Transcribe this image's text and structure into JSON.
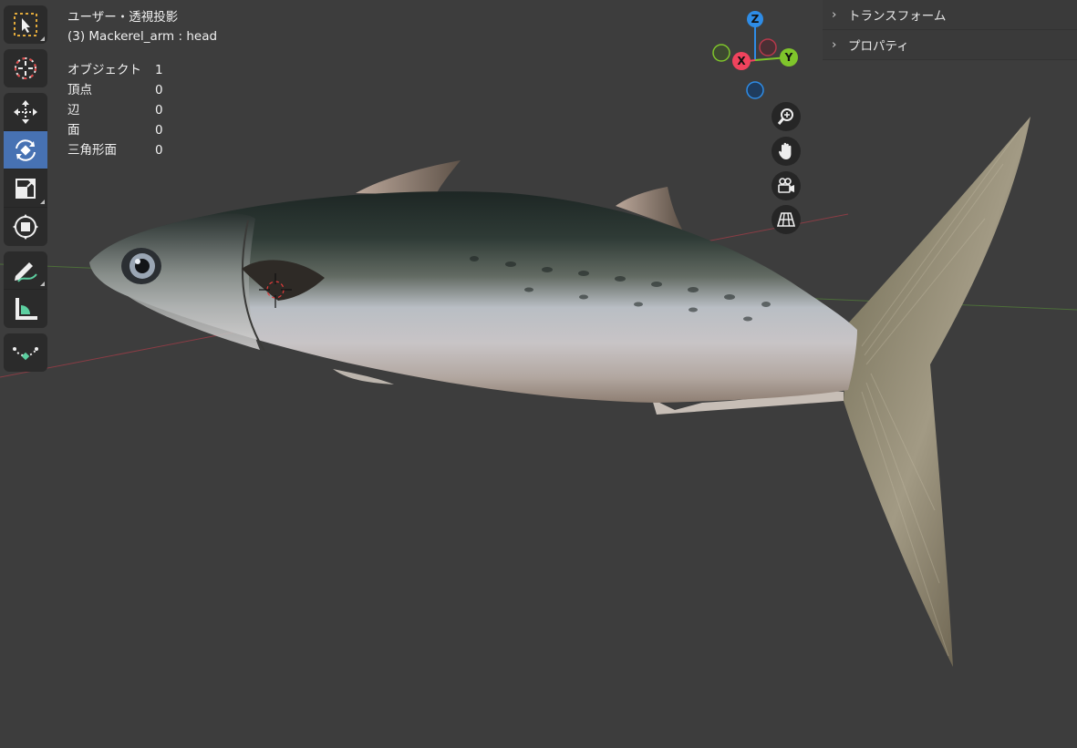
{
  "viewport": {
    "view_name": "ユーザー・透視投影",
    "object_info": "(3) Mackerel_arm : head"
  },
  "stats": {
    "object_label": "オブジェクト",
    "object_value": "1",
    "vertex_label": "頂点",
    "vertex_value": "0",
    "edge_label": "辺",
    "edge_value": "0",
    "face_label": "面",
    "face_value": "0",
    "tri_label": "三角形面",
    "tri_value": "0"
  },
  "gizmo": {
    "z": "Z",
    "x": "X",
    "y": "Y",
    "colors": {
      "x": "#f0435d",
      "y": "#7fc52b",
      "z": "#2e8ce6"
    }
  },
  "sidepanel": {
    "transform": "トランスフォーム",
    "properties": "プロパティ"
  },
  "toolbar": {
    "tools": [
      "select-box-icon",
      "cursor-icon",
      "move-icon",
      "rotate-icon",
      "scale-icon",
      "transform-icon",
      "annotate-icon",
      "measure-icon",
      "bone-envelope-icon"
    ],
    "active": "rotate-icon",
    "accent": "#4772b3"
  },
  "nav": {
    "icons": [
      "zoom-icon",
      "pan-hand-icon",
      "camera-view-icon",
      "ortho-grid-icon"
    ]
  }
}
